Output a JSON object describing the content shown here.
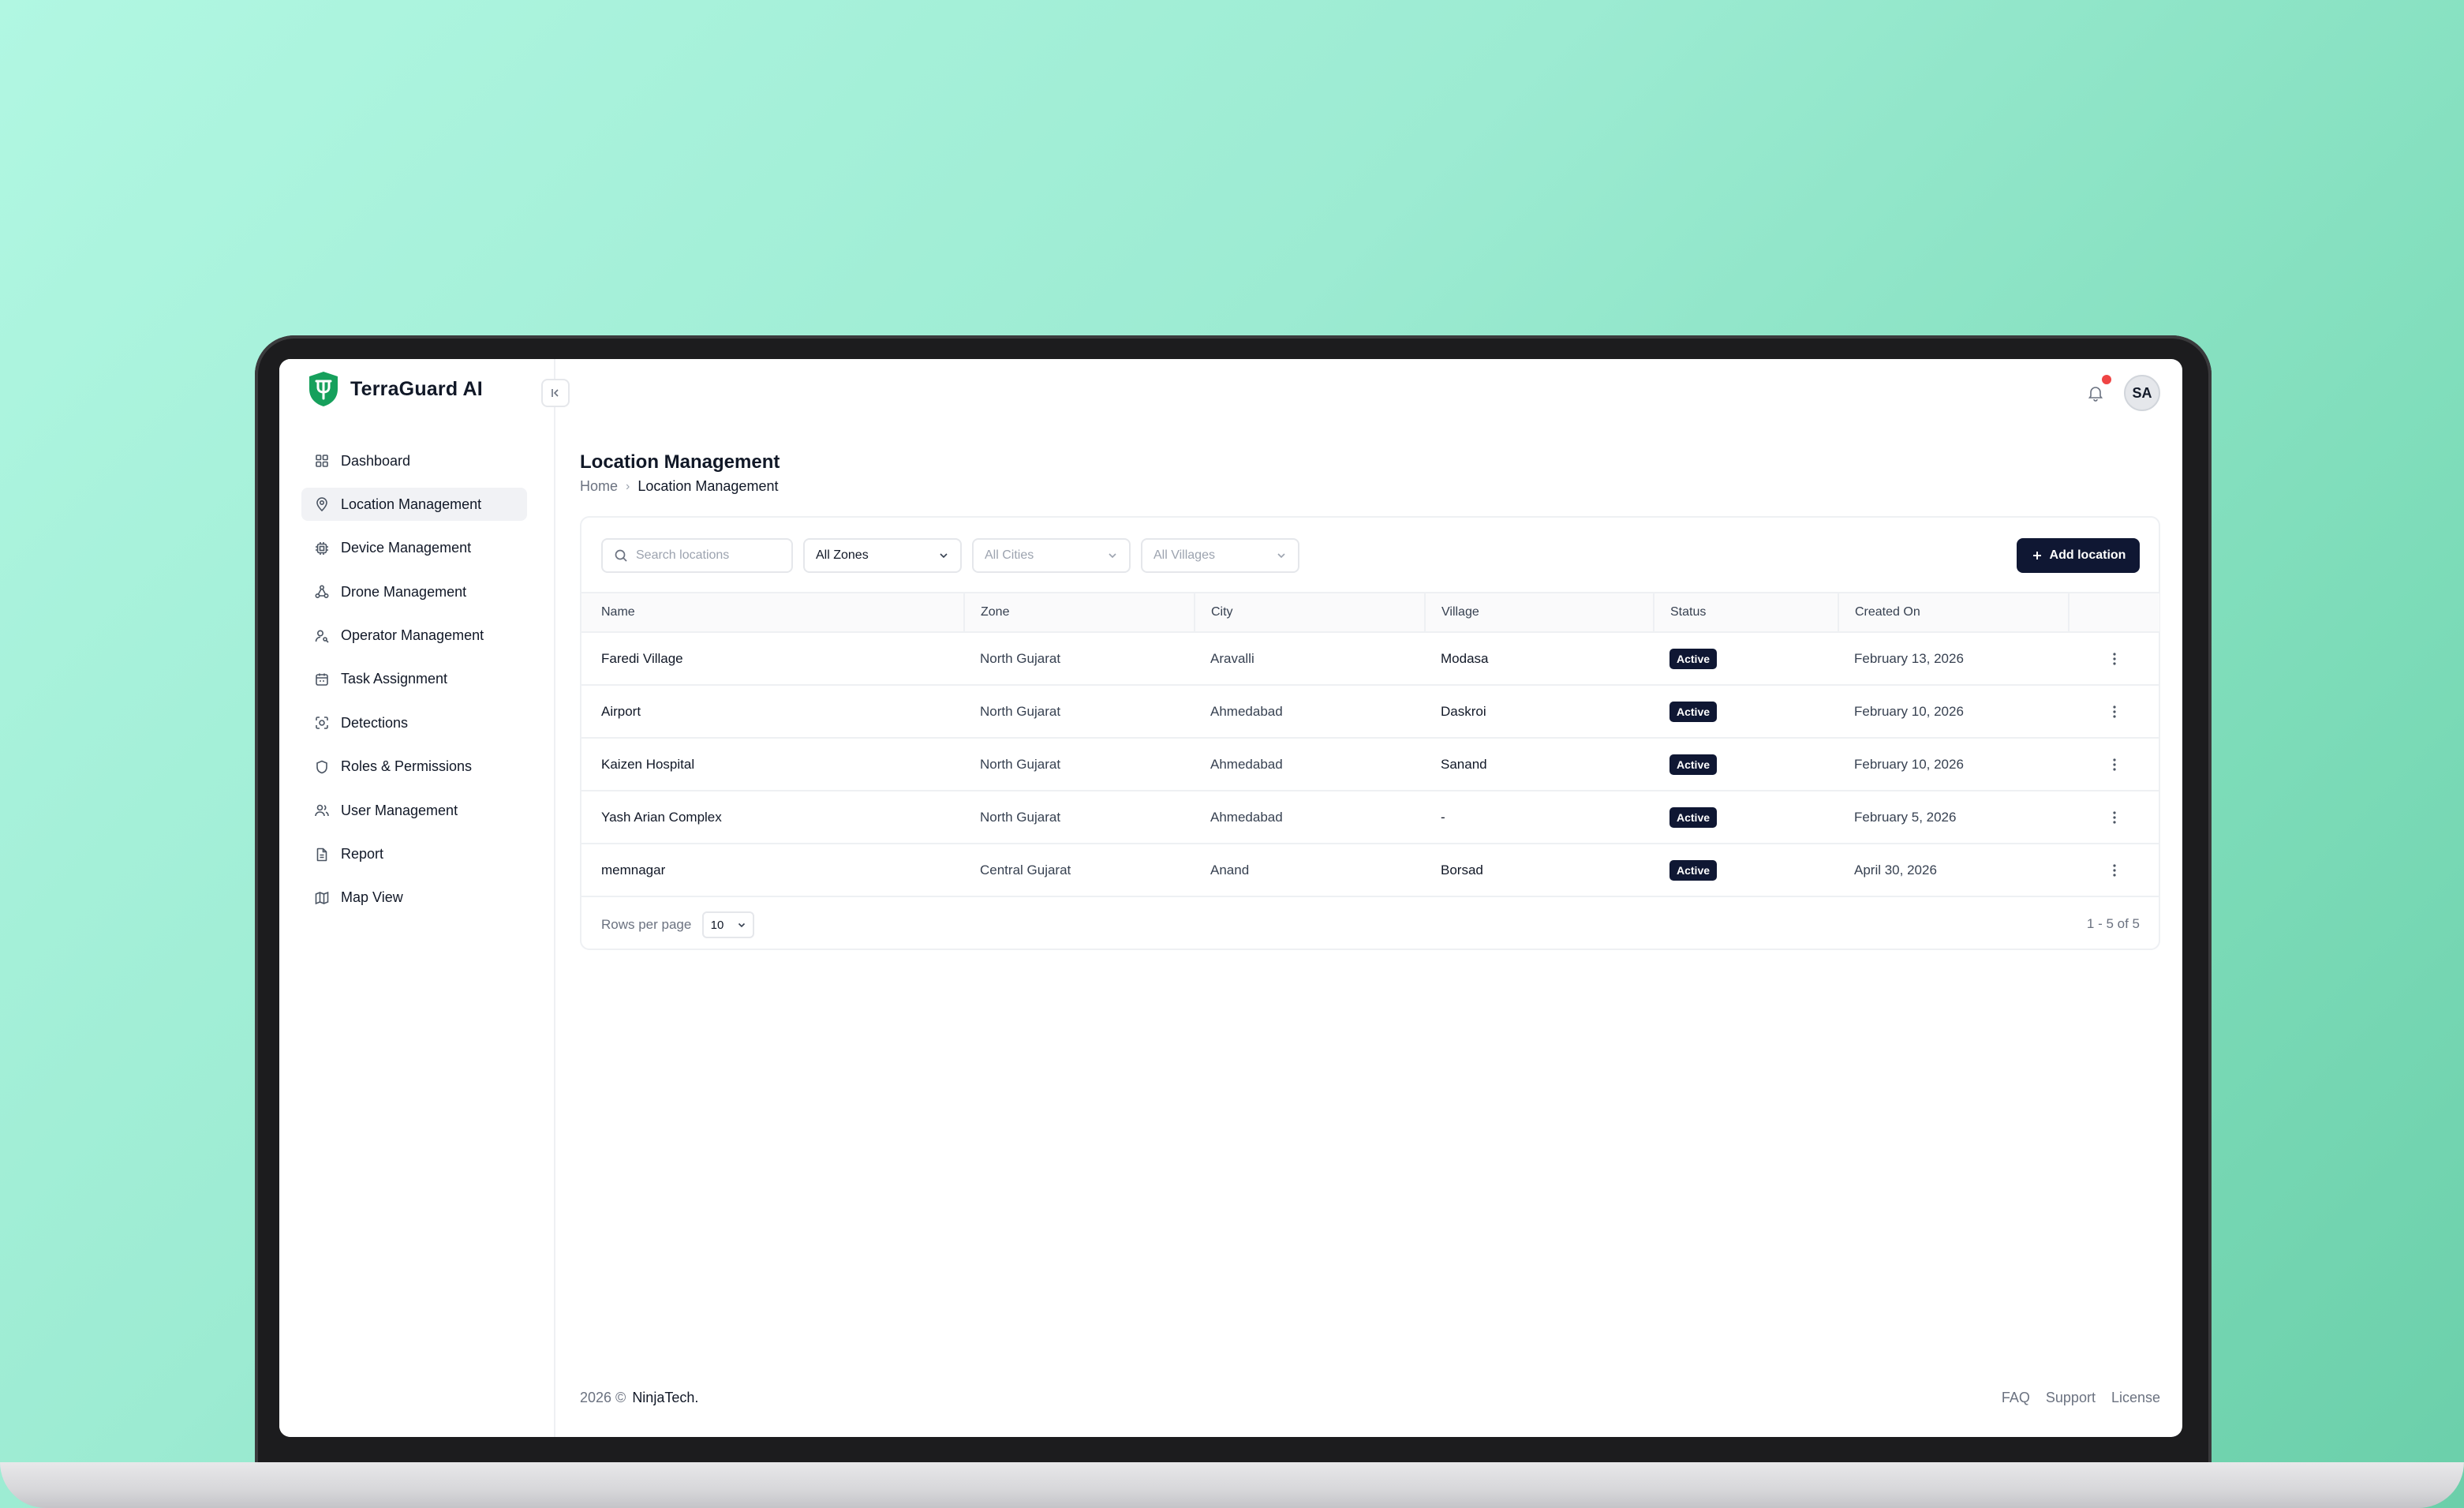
{
  "app": {
    "name": "TerraGuard AI"
  },
  "sidebar": {
    "items": [
      {
        "label": "Dashboard",
        "icon": "dashboard-icon"
      },
      {
        "label": "Location Management",
        "icon": "map-pin-icon"
      },
      {
        "label": "Device Management",
        "icon": "chip-icon"
      },
      {
        "label": "Drone Management",
        "icon": "drone-icon"
      },
      {
        "label": "Operator Management",
        "icon": "user-key-icon"
      },
      {
        "label": "Task Assignment",
        "icon": "calendar-icon"
      },
      {
        "label": "Detections",
        "icon": "scan-face-icon"
      },
      {
        "label": "Roles & Permissions",
        "icon": "shield-icon"
      },
      {
        "label": "User Management",
        "icon": "users-icon"
      },
      {
        "label": "Report",
        "icon": "file-icon"
      },
      {
        "label": "Map View",
        "icon": "map-icon"
      }
    ],
    "active_index": 1
  },
  "topbar": {
    "avatar_initials": "SA"
  },
  "header": {
    "title": "Location Management",
    "breadcrumb": {
      "home": "Home",
      "separator": "›",
      "current": "Location Management"
    }
  },
  "toolbar": {
    "search_placeholder": "Search locations",
    "zone_filter": "All Zones",
    "city_filter": "All Cities",
    "village_filter": "All Villages",
    "add_label": "Add location"
  },
  "table": {
    "headers": {
      "name": "Name",
      "zone": "Zone",
      "city": "City",
      "village": "Village",
      "status": "Status",
      "created": "Created On"
    },
    "rows": [
      {
        "name": "Faredi Village",
        "zone": "North Gujarat",
        "city": "Aravalli",
        "village": "Modasa",
        "status": "Active",
        "created": "February 13, 2026"
      },
      {
        "name": "Airport",
        "zone": "North Gujarat",
        "city": "Ahmedabad",
        "village": "Daskroi",
        "status": "Active",
        "created": "February 10, 2026"
      },
      {
        "name": "Kaizen Hospital",
        "zone": "North Gujarat",
        "city": "Ahmedabad",
        "village": "Sanand",
        "status": "Active",
        "created": "February 10, 2026"
      },
      {
        "name": "Yash Arian Complex",
        "zone": "North Gujarat",
        "city": "Ahmedabad",
        "village": "-",
        "status": "Active",
        "created": "February 5, 2026"
      },
      {
        "name": "memnagar",
        "zone": "Central Gujarat",
        "city": "Anand",
        "village": "Borsad",
        "status": "Active",
        "created": "April 30, 2026"
      }
    ]
  },
  "pagination": {
    "rows_label": "Rows per page",
    "rows_value": "10",
    "range": "1 - 5 of 5"
  },
  "footer": {
    "copyright": "2026 ©",
    "company": "NinjaTech.",
    "links": [
      "FAQ",
      "Support",
      "License"
    ]
  },
  "colors": {
    "brand_green": "#16a05c",
    "primary_navy": "#0f1733",
    "notification_red": "#ef4444"
  }
}
